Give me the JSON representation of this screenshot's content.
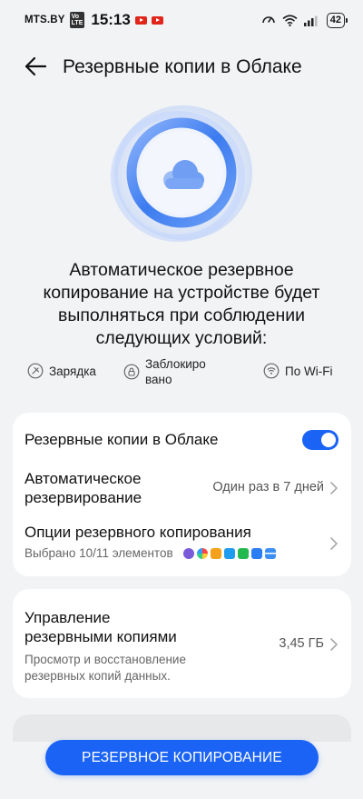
{
  "status_bar": {
    "carrier": "MTS.BY",
    "volte": "VoLTE",
    "time": "15:13",
    "battery": "42",
    "notification_icons": [
      "youtube-icon",
      "youtube-icon"
    ],
    "system_icons": [
      "speed-icon",
      "wifi-icon",
      "signal-icon",
      "battery-icon"
    ]
  },
  "header": {
    "title": "Резервные копии в Облаке",
    "back_icon": "arrow-left-icon"
  },
  "hero": {
    "icon": "cloud-icon",
    "colors": {
      "ring": "#4a86f0",
      "ring_light": "#c9d9fb",
      "cloud": "#6f9ef3"
    }
  },
  "description": "Автоматическое резервное копирование на устройстве будет выполняться при соблюдении следующих условий:",
  "conditions": [
    {
      "icon": "charging-icon",
      "label": "Зарядка"
    },
    {
      "icon": "lock-icon",
      "label_line1": "Заблокиро",
      "label_line2": "вано"
    },
    {
      "icon": "wifi-icon",
      "label": "По Wi-Fi"
    }
  ],
  "settings_card": {
    "cloud_backup": {
      "label": "Резервные копии в Облаке",
      "toggle_on": true
    },
    "auto_backup": {
      "label_line1": "Автоматическое",
      "label_line2": "резервирование",
      "value": "Один раз в 7 дней"
    },
    "backup_options": {
      "label": "Опции резервного копирования",
      "subtitle": "Выбрано 10/11 элементов",
      "app_icons": [
        "gallery-icon",
        "photos-icon",
        "files-icon",
        "messages-icon",
        "phone-icon",
        "contacts-icon",
        "notes-icon"
      ]
    }
  },
  "manage_card": {
    "label_line1": "Управление",
    "label_line2": "резервными копиями",
    "subtitle_line1": "Просмотр и восстановление",
    "subtitle_line2": "резервных копий данных.",
    "value": "3,45 ГБ"
  },
  "action_button": {
    "label": "РЕЗЕРВНОЕ КОПИРОВАНИЕ"
  },
  "colors": {
    "accent": "#1a63f5",
    "background": "#f1f3f5",
    "card": "#ffffff"
  }
}
